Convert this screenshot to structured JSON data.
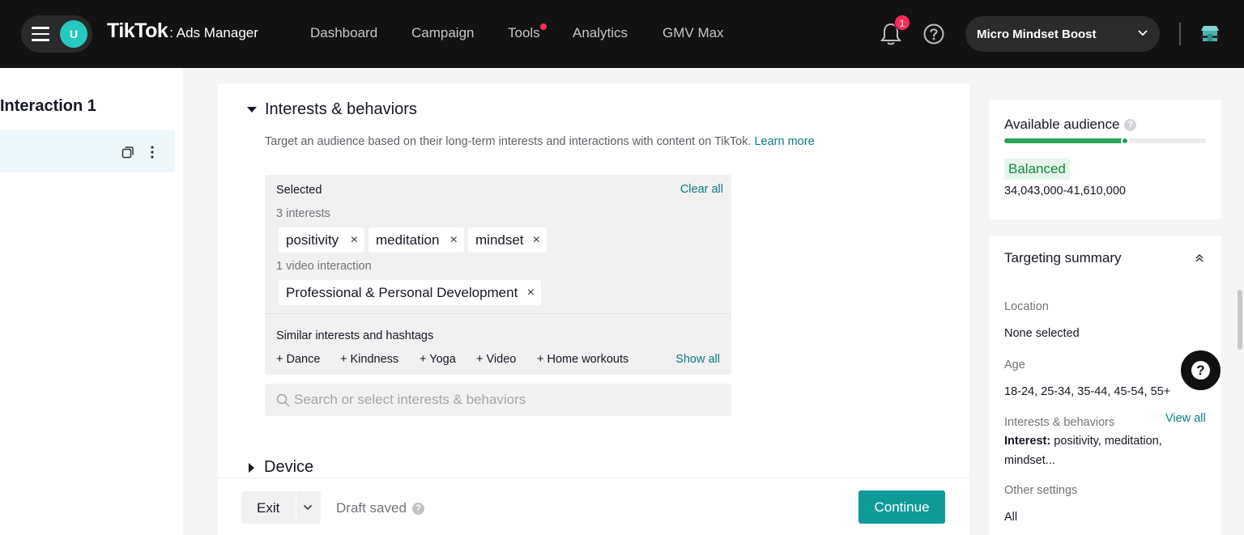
{
  "topbar": {
    "avatar_initial": "U",
    "brand_logo": "TikTok",
    "brand_sub": ": Ads Manager",
    "nav": [
      {
        "label": "Dashboard"
      },
      {
        "label": "Campaign"
      },
      {
        "label": "Tools"
      },
      {
        "label": "Analytics"
      },
      {
        "label": "GMV Max"
      }
    ],
    "notification_count": "1",
    "account_name": "Micro Mindset Boost",
    "icons": [
      "menu-icon",
      "bell-icon",
      "help-icon",
      "chevron-down-icon",
      "shop-icon"
    ]
  },
  "left_panel": {
    "title": "Interaction 1",
    "icons": [
      "copy-icon",
      "more-icon"
    ]
  },
  "interests": {
    "section_title": "Interests & behaviors",
    "description": "Target an audience based on their long-term interests and interactions with content on TikTok.",
    "learn_more": "Learn more",
    "selected_label": "Selected",
    "clear_all": "Clear all",
    "interests_count": "3 interests",
    "interest_chips": [
      "positivity",
      "meditation",
      "mindset"
    ],
    "video_count": "1 video interaction",
    "video_chips": [
      "Professional & Personal Development"
    ],
    "chip_remove": "×",
    "similar_label": "Similar interests and hashtags",
    "similar_items": [
      "+ Dance",
      "+ Kindness",
      "+ Yoga",
      "+ Video",
      "+ Home workouts"
    ],
    "show_all": "Show all",
    "search_placeholder": "Search or select interests & behaviors"
  },
  "device": {
    "title": "Device"
  },
  "footer": {
    "exit_label": "Exit",
    "draft_status": "Draft saved",
    "continue_label": "Continue"
  },
  "audience": {
    "title": "Available audience",
    "meter_level": 0.6,
    "status": "Balanced",
    "range": "34,043,000-41,610,000",
    "colors": {
      "meter": "#27a35c",
      "status_bg": "#e6f6ec",
      "status_text": "#15883f"
    }
  },
  "summary": {
    "title": "Targeting summary",
    "location_label": "Location",
    "location_value": "None selected",
    "age_label": "Age",
    "age_value": "18-24, 25-34, 35-44, 45-54, 55+",
    "interests_label": "Interests & behaviors",
    "view_all": "View all",
    "interest_prefix": "Interest:",
    "interest_value": "positivity, meditation, mindset...",
    "other_label": "Other settings",
    "other_value": "All"
  },
  "help_button": "?",
  "colors": {
    "accent": "#0f9b98",
    "link": "#0a7d80",
    "topbar": "#121212",
    "badge": "#fe2c55"
  }
}
